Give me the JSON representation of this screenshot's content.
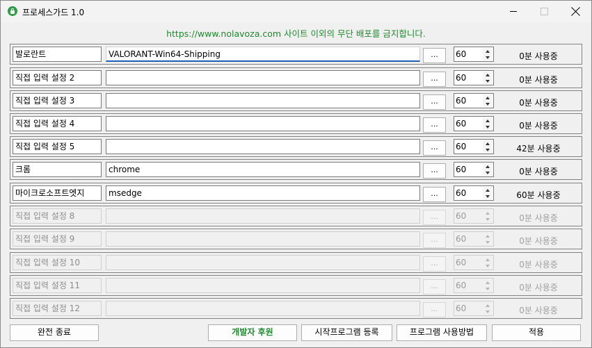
{
  "window": {
    "title": "프로세스가드 1.0"
  },
  "notice": "https://www.nolavoza.com 사이트 이외의 무단 배포를 금지합니다.",
  "rows": [
    {
      "name": "발로란트",
      "process": "VALORANT-Win64-Shipping",
      "browse_label": "...",
      "minutes": "60",
      "usage": "0분 사용중",
      "enabled": true,
      "focused": true
    },
    {
      "name": "직접 입력 설정 2",
      "process": "",
      "browse_label": "...",
      "minutes": "60",
      "usage": "0분 사용중",
      "enabled": true
    },
    {
      "name": "직접 입력 설정 3",
      "process": "",
      "browse_label": "...",
      "minutes": "60",
      "usage": "0분 사용중",
      "enabled": true
    },
    {
      "name": "직접 입력 설정 4",
      "process": "",
      "browse_label": "...",
      "minutes": "60",
      "usage": "0분 사용중",
      "enabled": true
    },
    {
      "name": "직접 입력 설정 5",
      "process": "",
      "browse_label": "...",
      "minutes": "60",
      "usage": "42분 사용중",
      "enabled": true
    },
    {
      "name": "크롬",
      "process": "chrome",
      "browse_label": "...",
      "minutes": "60",
      "usage": "0분 사용중",
      "enabled": true
    },
    {
      "name": "마이크로소프트엣지",
      "process": "msedge",
      "browse_label": "...",
      "minutes": "60",
      "usage": "60분 사용중",
      "enabled": true
    },
    {
      "name": "직접 입력 설정 8",
      "process": "",
      "browse_label": "...",
      "minutes": "60",
      "usage": "0분 사용중",
      "enabled": false
    },
    {
      "name": "직접 입력 설정 9",
      "process": "",
      "browse_label": "...",
      "minutes": "60",
      "usage": "0분 사용중",
      "enabled": false
    },
    {
      "name": "직접 입력 설정 10",
      "process": "",
      "browse_label": "...",
      "minutes": "60",
      "usage": "0분 사용중",
      "enabled": false
    },
    {
      "name": "직접 입력 설정 11",
      "process": "",
      "browse_label": "...",
      "minutes": "60",
      "usage": "0분 사용중",
      "enabled": false
    },
    {
      "name": "직접 입력 설정 12",
      "process": "",
      "browse_label": "...",
      "minutes": "60",
      "usage": "0분 사용중",
      "enabled": false
    }
  ],
  "buttons": {
    "exit": "완전 종료",
    "support": "개발자 후원",
    "startup": "시작프로그램 등록",
    "howto": "프로그램 사용방법",
    "apply": "적용"
  },
  "colors": {
    "notice": "#1f8a2e",
    "accent": "#1c5fb4",
    "brand_icon": "#2e9e44"
  },
  "icons": [
    "lock-icon",
    "minimize-icon",
    "maximize-icon",
    "close-icon",
    "spin-up-icon",
    "spin-down-icon"
  ]
}
